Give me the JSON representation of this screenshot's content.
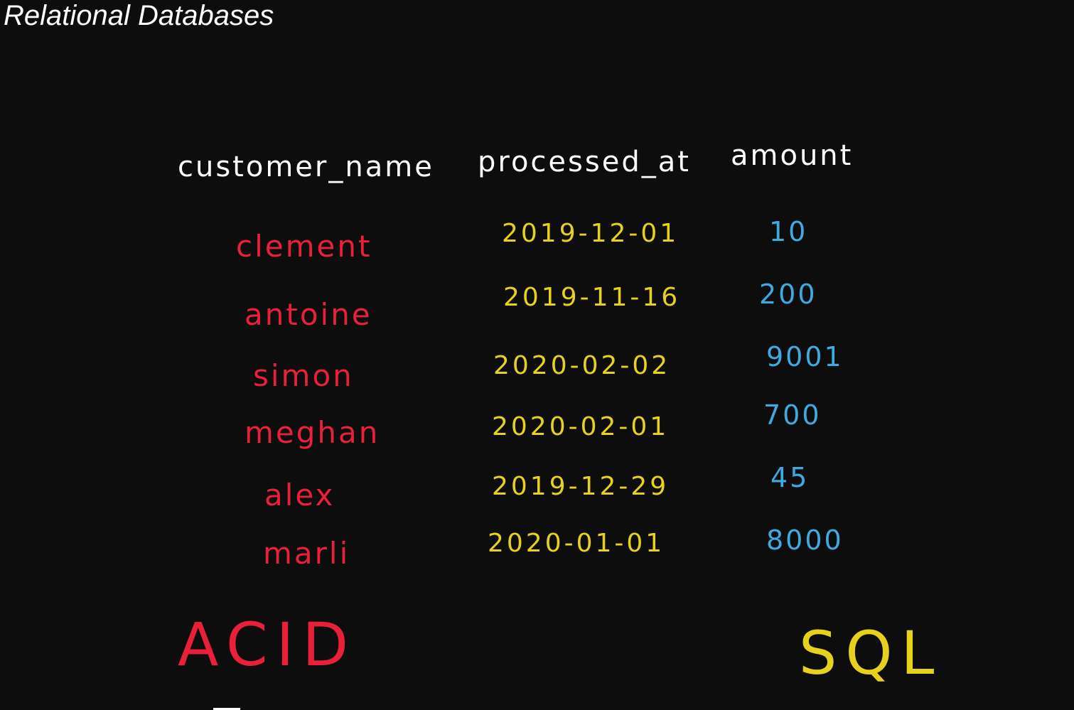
{
  "title": "Relational Databases",
  "table": {
    "headers": [
      "customer_name",
      "processed_at",
      "amount"
    ],
    "rows": [
      {
        "customer_name": "clement",
        "processed_at": "2019-12-01",
        "amount": "10"
      },
      {
        "customer_name": "antoine",
        "processed_at": "2019-11-16",
        "amount": "200"
      },
      {
        "customer_name": "simon",
        "processed_at": "2020-02-02",
        "amount": "9001"
      },
      {
        "customer_name": "meghan",
        "processed_at": "2020-02-01",
        "amount": "700"
      },
      {
        "customer_name": "alex",
        "processed_at": "2019-12-29",
        "amount": "45"
      },
      {
        "customer_name": "marli",
        "processed_at": "2020-01-01",
        "amount": "8000"
      }
    ]
  },
  "annotations": {
    "acid": "ACID",
    "sql": "SQL"
  },
  "colors": {
    "background": "#0d0d0d",
    "header": "#ffffff",
    "name": "#e8203a",
    "date": "#e6d21c",
    "amount": "#3fa9e0",
    "acid": "#e8203a",
    "sql": "#e6d21c"
  }
}
